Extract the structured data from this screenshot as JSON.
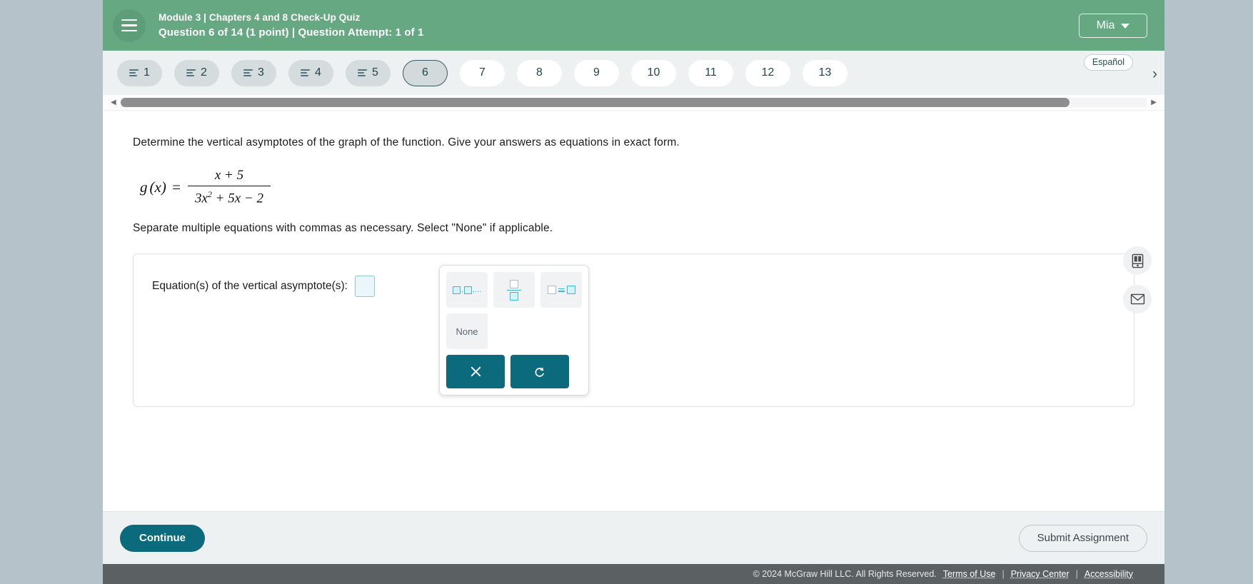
{
  "header": {
    "menu_icon": "hamburger-icon",
    "course_line": "Module 3 | Chapters 4 and 8 Check-Up Quiz",
    "question_line": "Question 6 of 14 (1 point)  |  Question Attempt: 1 of 1",
    "user_name": "Mia",
    "user_chevron": "chevron-down-icon"
  },
  "nav": {
    "espanol_label": "Español",
    "next_chevron": "chevron-right-icon",
    "pills": [
      {
        "label": "1",
        "state": "done"
      },
      {
        "label": "2",
        "state": "done"
      },
      {
        "label": "3",
        "state": "done"
      },
      {
        "label": "4",
        "state": "done"
      },
      {
        "label": "5",
        "state": "done"
      },
      {
        "label": "6",
        "state": "current"
      },
      {
        "label": "7",
        "state": "todo"
      },
      {
        "label": "8",
        "state": "todo"
      },
      {
        "label": "9",
        "state": "todo"
      },
      {
        "label": "10",
        "state": "todo"
      },
      {
        "label": "11",
        "state": "todo"
      },
      {
        "label": "12",
        "state": "todo"
      },
      {
        "label": "13",
        "state": "todo"
      }
    ]
  },
  "scrollbar": {
    "left_arrow": "caret-left-icon",
    "right_arrow": "caret-right-icon"
  },
  "question": {
    "prompt": "Determine the vertical asymptotes of the graph of the function. Give your answers as equations in exact form.",
    "function_name": "g",
    "function_var": "(x)",
    "equals": "=",
    "numerator": "x + 5",
    "denominator_a": "3x",
    "denominator_exp": "2",
    "denominator_b": " + 5x − 2",
    "subprompt": "Separate multiple equations with commas as necessary. Select \"None\" if applicable."
  },
  "answer": {
    "label": "Equation(s) of the vertical asymptote(s):",
    "value": "",
    "placeholder": ""
  },
  "keypad": {
    "list_icon": "comma-list-template-icon",
    "list_suffix": ",...",
    "fraction_icon": "fraction-template-icon",
    "equation_icon": "equation-template-icon",
    "none_label": "None",
    "clear_icon": "close-x-icon",
    "undo_icon": "undo-arrow-icon"
  },
  "tools": {
    "reference_icon": "book-reference-icon",
    "message_icon": "envelope-icon"
  },
  "footer_bar": {
    "continue_label": "Continue",
    "submit_label": "Submit Assignment"
  },
  "legal": {
    "copyright": "© 2024 McGraw Hill LLC. All Rights Reserved.",
    "terms": "Terms of Use",
    "privacy": "Privacy Center",
    "accessibility": "Accessibility",
    "separator": "|"
  },
  "colors": {
    "header_green": "#65a881",
    "teal_action": "#0b6b7c",
    "nav_bg": "#eef1f2",
    "cyan_accent": "#35bdd8"
  }
}
